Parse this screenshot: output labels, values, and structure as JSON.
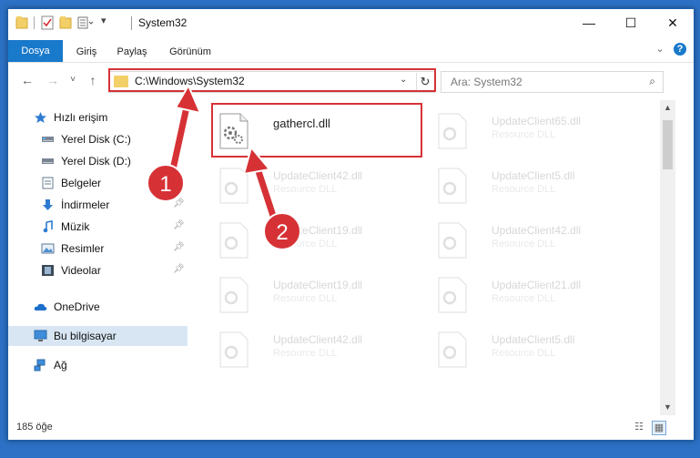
{
  "window": {
    "title": "System32",
    "controls": {
      "minimize": "—",
      "maximize": "☐",
      "close": "✕"
    }
  },
  "ribbon": {
    "tabs": [
      "Dosya",
      "Giriş",
      "Paylaş",
      "Görünüm"
    ],
    "collapse_icon": "chevron-down-icon",
    "help_icon": "?"
  },
  "nav": {
    "back": "←",
    "forward": "→",
    "recent": "˅",
    "up": "↑"
  },
  "address": {
    "path": "C:\\Windows\\System32",
    "dropdown": "⌄",
    "refresh": "↻"
  },
  "search": {
    "placeholder": "Ara: System32",
    "icon": "⌕"
  },
  "sidebar": {
    "items": [
      {
        "label": "Hızlı erişim",
        "icon": "star-icon",
        "pinned": false,
        "selected": false
      },
      {
        "label": "Yerel Disk (C:)",
        "icon": "drive-icon",
        "pinned": false,
        "selected": false
      },
      {
        "label": "Yerel Disk (D:)",
        "icon": "drive-icon",
        "pinned": false,
        "selected": false
      },
      {
        "label": "Belgeler",
        "icon": "documents-icon",
        "pinned": false,
        "selected": false
      },
      {
        "label": "İndirmeler",
        "icon": "download-icon",
        "pinned": true,
        "selected": false
      },
      {
        "label": "Müzik",
        "icon": "music-icon",
        "pinned": true,
        "selected": false
      },
      {
        "label": "Resimler",
        "icon": "pictures-icon",
        "pinned": true,
        "selected": false
      },
      {
        "label": "Videolar",
        "icon": "video-icon",
        "pinned": true,
        "selected": false
      },
      {
        "label": "OneDrive",
        "icon": "cloud-icon",
        "pinned": false,
        "selected": false
      },
      {
        "label": "Bu bilgisayar",
        "icon": "computer-icon",
        "pinned": false,
        "selected": true
      },
      {
        "label": "Ağ",
        "icon": "network-icon",
        "pinned": false,
        "selected": false
      }
    ]
  },
  "files": [
    {
      "name": "gathercl.dll",
      "type": "",
      "faded": false
    },
    {
      "name": "UpdateClient65.dll",
      "type": "Resource DLL",
      "faded": true
    },
    {
      "name": "UpdateClient42.dll",
      "type": "Resource DLL",
      "faded": true
    },
    {
      "name": "UpdateClient5.dll",
      "type": "Resource DLL",
      "faded": true
    },
    {
      "name": "UpdateClient19.dll",
      "type": "Resource DLL",
      "faded": true
    },
    {
      "name": "UpdateClient42.dll",
      "type": "Resource DLL",
      "faded": true
    },
    {
      "name": "UpdateClient19.dll",
      "type": "Resource DLL",
      "faded": true
    },
    {
      "name": "UpdateClient21.dll",
      "type": "Resource DLL",
      "faded": true
    },
    {
      "name": "UpdateClient42.dll",
      "type": "Resource DLL",
      "faded": true
    },
    {
      "name": "UpdateClient5.dll",
      "type": "Resource DLL",
      "faded": true
    }
  ],
  "status": {
    "item_count": "185 öğe"
  },
  "annotations": {
    "step1": "1",
    "step2": "2",
    "color": "#d63236"
  }
}
